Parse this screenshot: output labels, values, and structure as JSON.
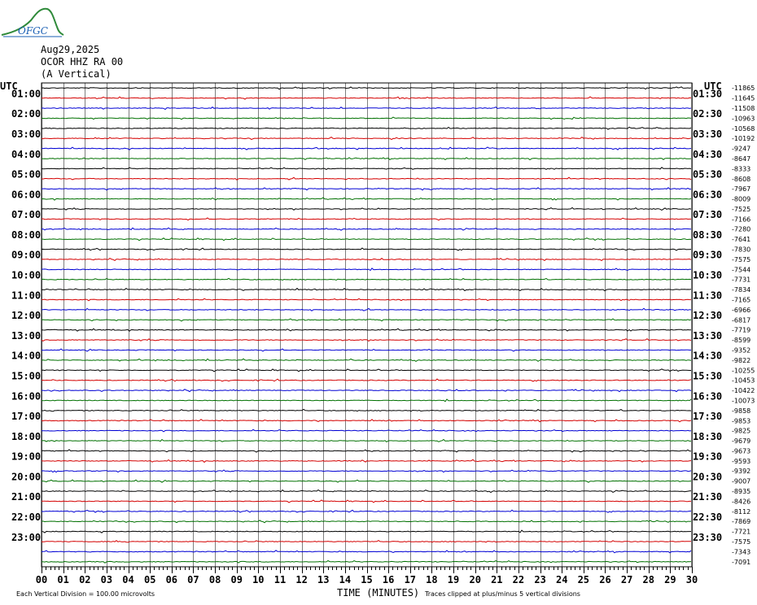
{
  "logo_text": "OFGC",
  "header": {
    "date": "Aug29,2025",
    "station": "OCOR HHZ RA 00",
    "component": "(A Vertical)"
  },
  "axis": {
    "left_label": "UTC",
    "right_label": "UTC",
    "xlabel": "TIME (MINUTES)"
  },
  "footer": {
    "left": "Each Vertical Division =  100.00 microvolts",
    "right": "Traces clipped at plus/minus 5 vertical divisions"
  },
  "chart_data": {
    "type": "seismogram",
    "title": "Aug29,2025 OCOR HHZ RA 00 (A Vertical)",
    "xlabel": "TIME (MINUTES)",
    "x_ticks": [
      "00",
      "01",
      "02",
      "03",
      "04",
      "05",
      "06",
      "07",
      "08",
      "09",
      "10",
      "11",
      "12",
      "13",
      "14",
      "15",
      "16",
      "17",
      "18",
      "19",
      "20",
      "21",
      "22",
      "23",
      "24",
      "25",
      "26",
      "27",
      "28",
      "29",
      "30"
    ],
    "xlim": [
      0,
      30
    ],
    "trace_colors": [
      "#000000",
      "#d40000",
      "#0000d4",
      "#007000"
    ],
    "left_hour_labels": [
      "01:00",
      "02:00",
      "03:00",
      "04:00",
      "05:00",
      "06:00",
      "07:00",
      "08:00",
      "09:00",
      "10:00",
      "11:00",
      "12:00",
      "13:00",
      "14:00",
      "15:00",
      "16:00",
      "17:00",
      "18:00",
      "19:00",
      "20:00",
      "21:00",
      "22:00",
      "23:00"
    ],
    "right_hour_labels": [
      "01:30",
      "02:30",
      "03:30",
      "04:30",
      "05:30",
      "06:30",
      "07:30",
      "08:30",
      "09:30",
      "10:30",
      "11:30",
      "12:30",
      "13:30",
      "14:30",
      "15:30",
      "16:30",
      "17:30",
      "18:30",
      "19:30",
      "20:30",
      "21:30",
      "22:30",
      "23:30"
    ],
    "trace_offsets": [
      "-11865",
      "-11645",
      "-11508",
      "-10963",
      "-10568",
      "-10192",
      "-9247",
      "-8647",
      "-8333",
      "-8608",
      "-7967",
      "-8009",
      "-7525",
      "-7166",
      "-7280",
      "-7641",
      "-7830",
      "-7575",
      "-7544",
      "-7731",
      "-7834",
      "-7165",
      "-6966",
      "-6817",
      "-7719",
      "-8599",
      "-9352",
      "-9822",
      "-10255",
      "-10453",
      "-10422",
      "-10073",
      "-9858",
      "-9853",
      "-9825",
      "-9679",
      "-9673",
      "-9593",
      "-9392",
      "-9007",
      "-8935",
      "-8426",
      "-8112",
      "-7869",
      "-7721",
      "-7575",
      "-7343",
      "-7091"
    ],
    "scale": "100.00 microvolts per vertical division",
    "clip": "plus/minus 5 vertical divisions"
  }
}
